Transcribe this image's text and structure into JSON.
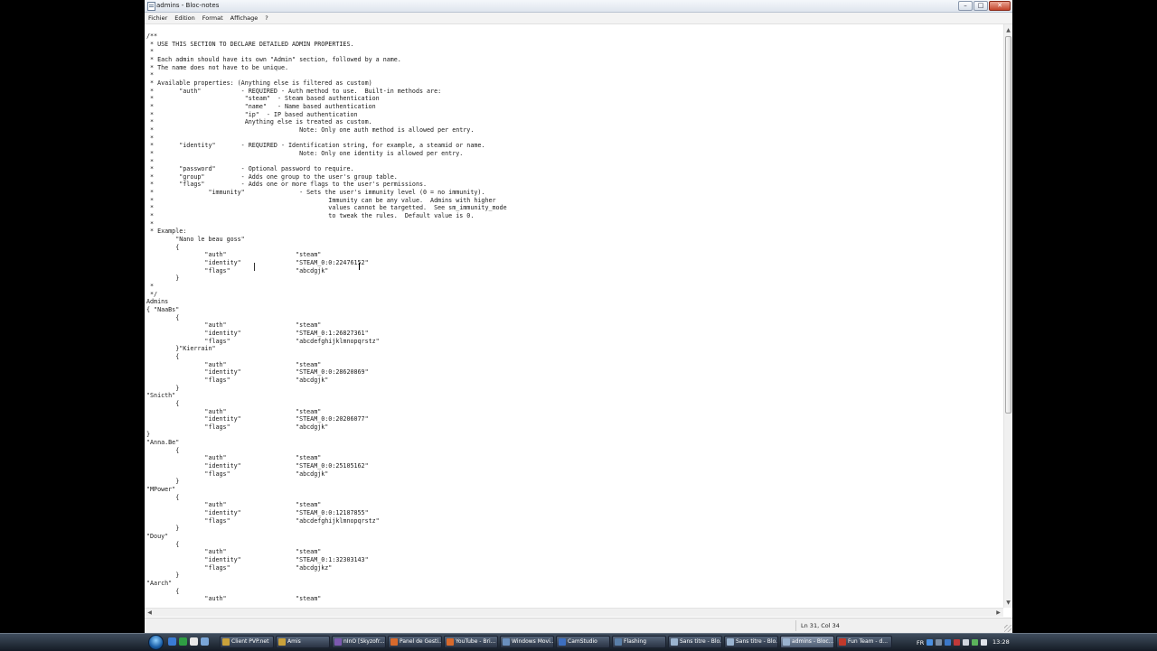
{
  "window": {
    "title": "admins - Bloc-notes",
    "controls": {
      "minimize": "–",
      "maximize": "□",
      "close": "✕"
    }
  },
  "menu": [
    "Fichier",
    "Edition",
    "Format",
    "Affichage",
    "?"
  ],
  "editor": {
    "lines": [
      "/**",
      " * USE THIS SECTION TO DECLARE DETAILED ADMIN PROPERTIES.",
      " *",
      " * Each admin should have its own \"Admin\" section, followed by a name.",
      " * The name does not have to be unique.",
      " *",
      " * Available properties: (Anything else is filtered as custom)",
      " *       \"auth\"           - REQUIRED - Auth method to use.  Built-in methods are:",
      " *                         \"steam\"  - Steam based authentication",
      " *                         \"name\"   - Name based authentication",
      " *                         \"ip\"  - IP based authentication",
      " *                         Anything else is treated as custom.",
      " *                                        Note: Only one auth method is allowed per entry.",
      " *",
      " *       \"identity\"       - REQUIRED - Identification string, for example, a steamid or name.",
      " *                                        Note: Only one identity is allowed per entry.",
      " *",
      " *       \"password\"       - Optional password to require.",
      " *       \"group\"          - Adds one group to the user's group table.",
      " *       \"flags\"          - Adds one or more flags to the user's permissions.",
      " *               \"immunity\"               - Sets the user's immunity level (0 = no immunity).",
      " *                                                Immunity can be any value.  Admins with higher",
      " *                                                values cannot be targetted.  See sm_immunity_mode",
      " *                                                to tweak the rules.  Default value is 0.",
      " *",
      " * Example:",
      "        \"Nano le beau goss\"",
      "        {",
      "                \"auth\"                   \"steam\"",
      "                \"identity\"               \"STEAM_0:0:22476152\"",
      "                \"flags\"                  \"abcdgjk\"",
      "        }",
      " *",
      " */",
      "Admins",
      "{ \"NaaBs\"",
      "        {",
      "                \"auth\"                   \"steam\"",
      "                \"identity\"               \"STEAM_0:1:26827361\"",
      "                \"flags\"                  \"abcdefghijklmnopqrstz\"",
      "        }\"Kierrain\"",
      "        {",
      "                \"auth\"                   \"steam\"",
      "                \"identity\"               \"STEAM_0:0:28620869\"",
      "                \"flags\"                  \"abcdgjk\"",
      "        }",
      "\"Snicth\"",
      "        {",
      "                \"auth\"                   \"steam\"",
      "                \"identity\"               \"STEAM_0:0:20206077\"",
      "                \"flags\"                  \"abcdgjk\"",
      "}",
      "\"Anna.Be\"",
      "        {",
      "                \"auth\"                   \"steam\"",
      "                \"identity\"               \"STEAM_0:0:25105162\"",
      "                \"flags\"                  \"abcdgjk\"",
      "        }",
      "\"MPower\"",
      "        {",
      "                \"auth\"                   \"steam\"",
      "                \"identity\"               \"STEAM_0:0:12187855\"",
      "                \"flags\"                  \"abcdefghijklmnopqrstz\"",
      "        }",
      "\"Douy\"",
      "        {",
      "                \"auth\"                   \"steam\"",
      "                \"identity\"               \"STEAM_0:1:32303143\"",
      "                \"flags\"                  \"abcdgjkz\"",
      "        }",
      "\"Aarch\"",
      "        {",
      "                \"auth\"                   \"steam\""
    ]
  },
  "statusbar": {
    "position": "Ln 31, Col 34"
  },
  "taskbar": {
    "tasks": [
      {
        "label": "Client PVP.net",
        "color": "#c9a13b"
      },
      {
        "label": "Amis",
        "color": "#c9a13b"
      },
      {
        "label": "nInO [Skyzofr...",
        "color": "#7c59b0"
      },
      {
        "label": "Panel de Gesti...",
        "color": "#d86a2c"
      },
      {
        "label": "YouTube - Bri...",
        "color": "#d86a2c"
      },
      {
        "label": "Windows Movi...",
        "color": "#6a8fbd"
      },
      {
        "label": "CamStudio",
        "color": "#3d6fc0"
      },
      {
        "label": "Flashing",
        "color": "#5a7fa8"
      },
      {
        "label": "Sans titre - Blo...",
        "color": "#9ab3cf"
      },
      {
        "label": "Sans titre - Blo...",
        "color": "#9ab3cf"
      },
      {
        "label": "admins - Bloc...",
        "color": "#9ab3cf"
      },
      {
        "label": "Fun Team - d...",
        "color": "#c0392b"
      }
    ],
    "language": "FR",
    "clock": "13:28"
  }
}
